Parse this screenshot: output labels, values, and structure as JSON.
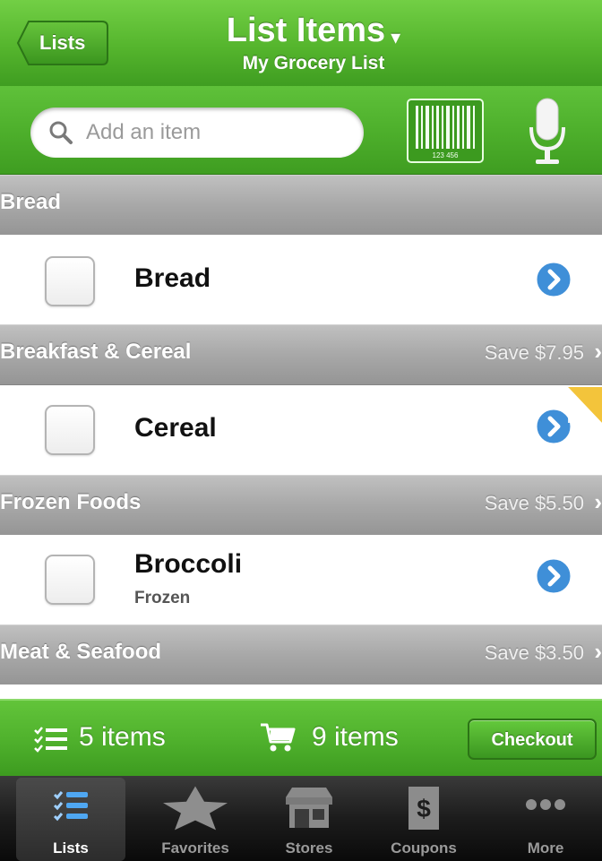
{
  "header": {
    "back_label": "Lists",
    "title": "List Items",
    "title_caret": "▾",
    "subtitle": "My Grocery List"
  },
  "search": {
    "placeholder": "Add an item",
    "barcode_digits": "123 456"
  },
  "sections": [
    {
      "name": "Bread",
      "save": "",
      "items": [
        {
          "name": "Bread",
          "note": ""
        }
      ]
    },
    {
      "name": "Breakfast & Cereal",
      "save": "Save $7.95",
      "items": [
        {
          "name": "Cereal",
          "note": ""
        }
      ]
    },
    {
      "name": "Frozen Foods",
      "save": "Save $5.50",
      "items": [
        {
          "name": "Broccoli",
          "note": "Frozen"
        }
      ]
    },
    {
      "name": "Meat & Seafood",
      "save": "Save $3.50",
      "items": []
    }
  ],
  "summary": {
    "remaining": "5 items",
    "cart": "9 items",
    "checkout_label": "Checkout"
  },
  "tabs": [
    {
      "label": "Lists",
      "icon": "list-icon",
      "active": true
    },
    {
      "label": "Favorites",
      "icon": "star-icon",
      "active": false
    },
    {
      "label": "Stores",
      "icon": "store-icon",
      "active": false
    },
    {
      "label": "Coupons",
      "icon": "coupon-icon",
      "active": false
    },
    {
      "label": "More",
      "icon": "more-icon",
      "active": false
    }
  ],
  "colors": {
    "header_green": "#55b52d",
    "section_gray": "#a8a8a8",
    "detail_blue": "#3f8fd8",
    "tabbar_dark": "#1c1c1c"
  }
}
